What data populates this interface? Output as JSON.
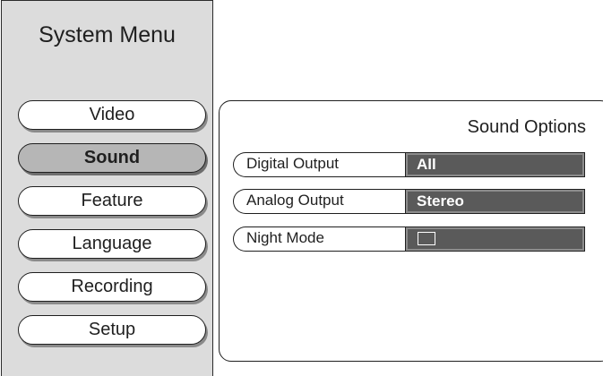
{
  "sidebar": {
    "title": "System Menu",
    "items": [
      {
        "label": "Video",
        "selected": false
      },
      {
        "label": "Sound",
        "selected": true
      },
      {
        "label": "Feature",
        "selected": false
      },
      {
        "label": "Language",
        "selected": false
      },
      {
        "label": "Recording",
        "selected": false
      },
      {
        "label": "Setup",
        "selected": false
      }
    ]
  },
  "panel": {
    "title": "Sound Options",
    "options": [
      {
        "label": "Digital Output",
        "value": "All"
      },
      {
        "label": "Analog Output",
        "value": "Stereo"
      },
      {
        "label": "Night Mode",
        "value": "",
        "control": "checkbox",
        "checked": false
      }
    ]
  },
  "colors": {
    "sidebar_bg": "#dcdcdc",
    "selected_item_bg": "#b6b6b6",
    "value_field_bg": "#5a5a5a",
    "text": "#1f1f1f"
  }
}
